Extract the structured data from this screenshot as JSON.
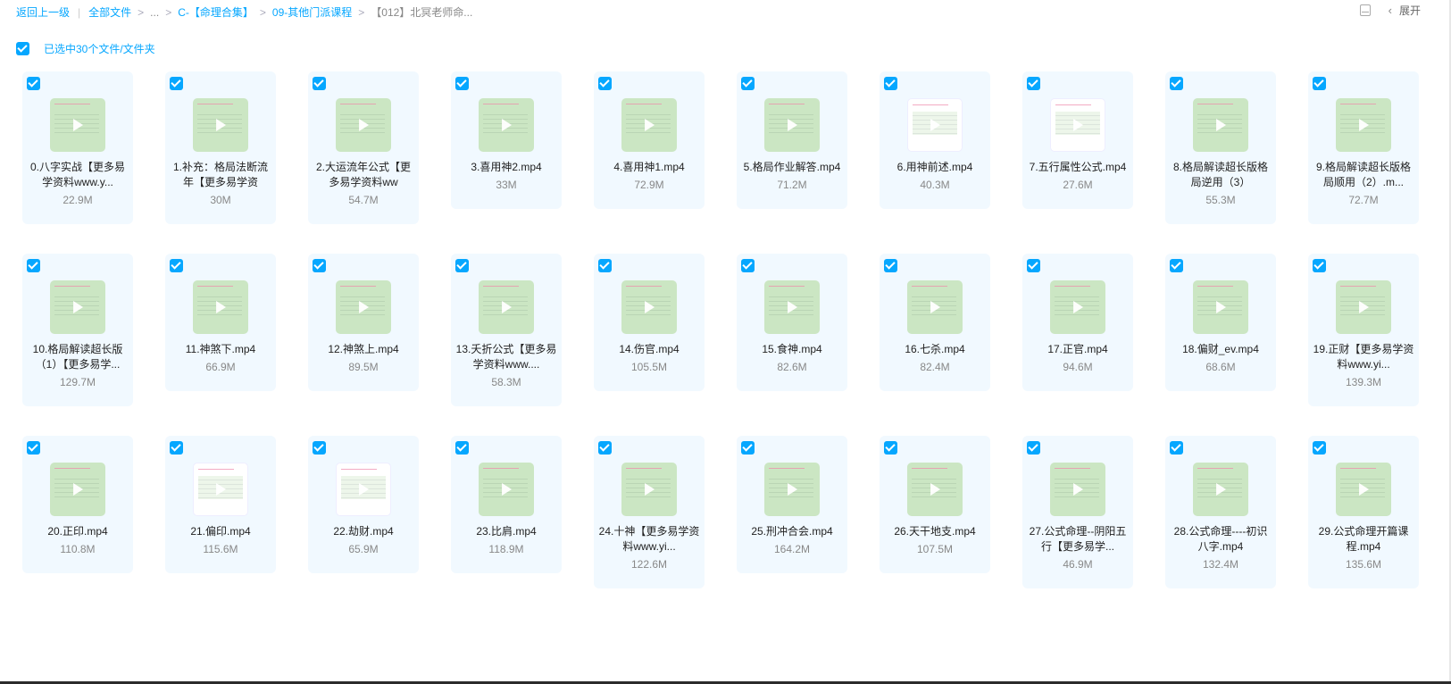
{
  "breadcrumb": {
    "back": "返回上一级",
    "all_files": "全部文件",
    "ellipsis": "...",
    "level1": "C-【命理合集】",
    "level2": "09-其他门派课程",
    "current": "【012】北冥老师命..."
  },
  "top_right": {
    "expand_label": "展开"
  },
  "selection": {
    "text": "已选中30个文件/文件夹"
  },
  "files": [
    {
      "name": "0.八字实战【更多易学资料www.y...",
      "size": "22.9M",
      "thumb": "green"
    },
    {
      "name": "1.补充：格局法断流年【更多易学资",
      "size": "30M",
      "thumb": "green"
    },
    {
      "name": "2.大运流年公式【更多易学资料ww",
      "size": "54.7M",
      "thumb": "green"
    },
    {
      "name": "3.喜用神2.mp4",
      "size": "33M",
      "thumb": "green"
    },
    {
      "name": "4.喜用神1.mp4",
      "size": "72.9M",
      "thumb": "green"
    },
    {
      "name": "5.格局作业解答.mp4",
      "size": "71.2M",
      "thumb": "green"
    },
    {
      "name": "6.用神前述.mp4",
      "size": "40.3M",
      "thumb": "white"
    },
    {
      "name": "7.五行属性公式.mp4",
      "size": "27.6M",
      "thumb": "white"
    },
    {
      "name": "8.格局解读超长版格局逆用（3）",
      "size": "55.3M",
      "thumb": "green"
    },
    {
      "name": "9.格局解读超长版格局顺用（2）.m...",
      "size": "72.7M",
      "thumb": "green"
    },
    {
      "name": "10.格局解读超长版（1）【更多易学...",
      "size": "129.7M",
      "thumb": "green"
    },
    {
      "name": "11.神煞下.mp4",
      "size": "66.9M",
      "thumb": "green"
    },
    {
      "name": "12.神煞上.mp4",
      "size": "89.5M",
      "thumb": "green"
    },
    {
      "name": "13.夭折公式【更多易学资料www....",
      "size": "58.3M",
      "thumb": "green"
    },
    {
      "name": "14.伤官.mp4",
      "size": "105.5M",
      "thumb": "green"
    },
    {
      "name": "15.食神.mp4",
      "size": "82.6M",
      "thumb": "green"
    },
    {
      "name": "16.七杀.mp4",
      "size": "82.4M",
      "thumb": "green"
    },
    {
      "name": "17.正官.mp4",
      "size": "94.6M",
      "thumb": "green"
    },
    {
      "name": "18.偏财_ev.mp4",
      "size": "68.6M",
      "thumb": "green"
    },
    {
      "name": "19.正财【更多易学资料www.yi...",
      "size": "139.3M",
      "thumb": "green"
    },
    {
      "name": "20.正印.mp4",
      "size": "110.8M",
      "thumb": "green"
    },
    {
      "name": "21.偏印.mp4",
      "size": "115.6M",
      "thumb": "white"
    },
    {
      "name": "22.劫财.mp4",
      "size": "65.9M",
      "thumb": "white"
    },
    {
      "name": "23.比肩.mp4",
      "size": "118.9M",
      "thumb": "green"
    },
    {
      "name": "24.十神【更多易学资料www.yi...",
      "size": "122.6M",
      "thumb": "green"
    },
    {
      "name": "25.刑冲合会.mp4",
      "size": "164.2M",
      "thumb": "green"
    },
    {
      "name": "26.天干地支.mp4",
      "size": "107.5M",
      "thumb": "green"
    },
    {
      "name": "27.公式命理--阴阳五行【更多易学...",
      "size": "46.9M",
      "thumb": "green"
    },
    {
      "name": "28.公式命理----初识八字.mp4",
      "size": "132.4M",
      "thumb": "green"
    },
    {
      "name": "29.公式命理开篇课程.mp4",
      "size": "135.6M",
      "thumb": "green"
    }
  ],
  "colors": {
    "accent": "#06a7ff",
    "card_bg": "#f1f9ff",
    "thumb_green": "#cbe6c3"
  }
}
